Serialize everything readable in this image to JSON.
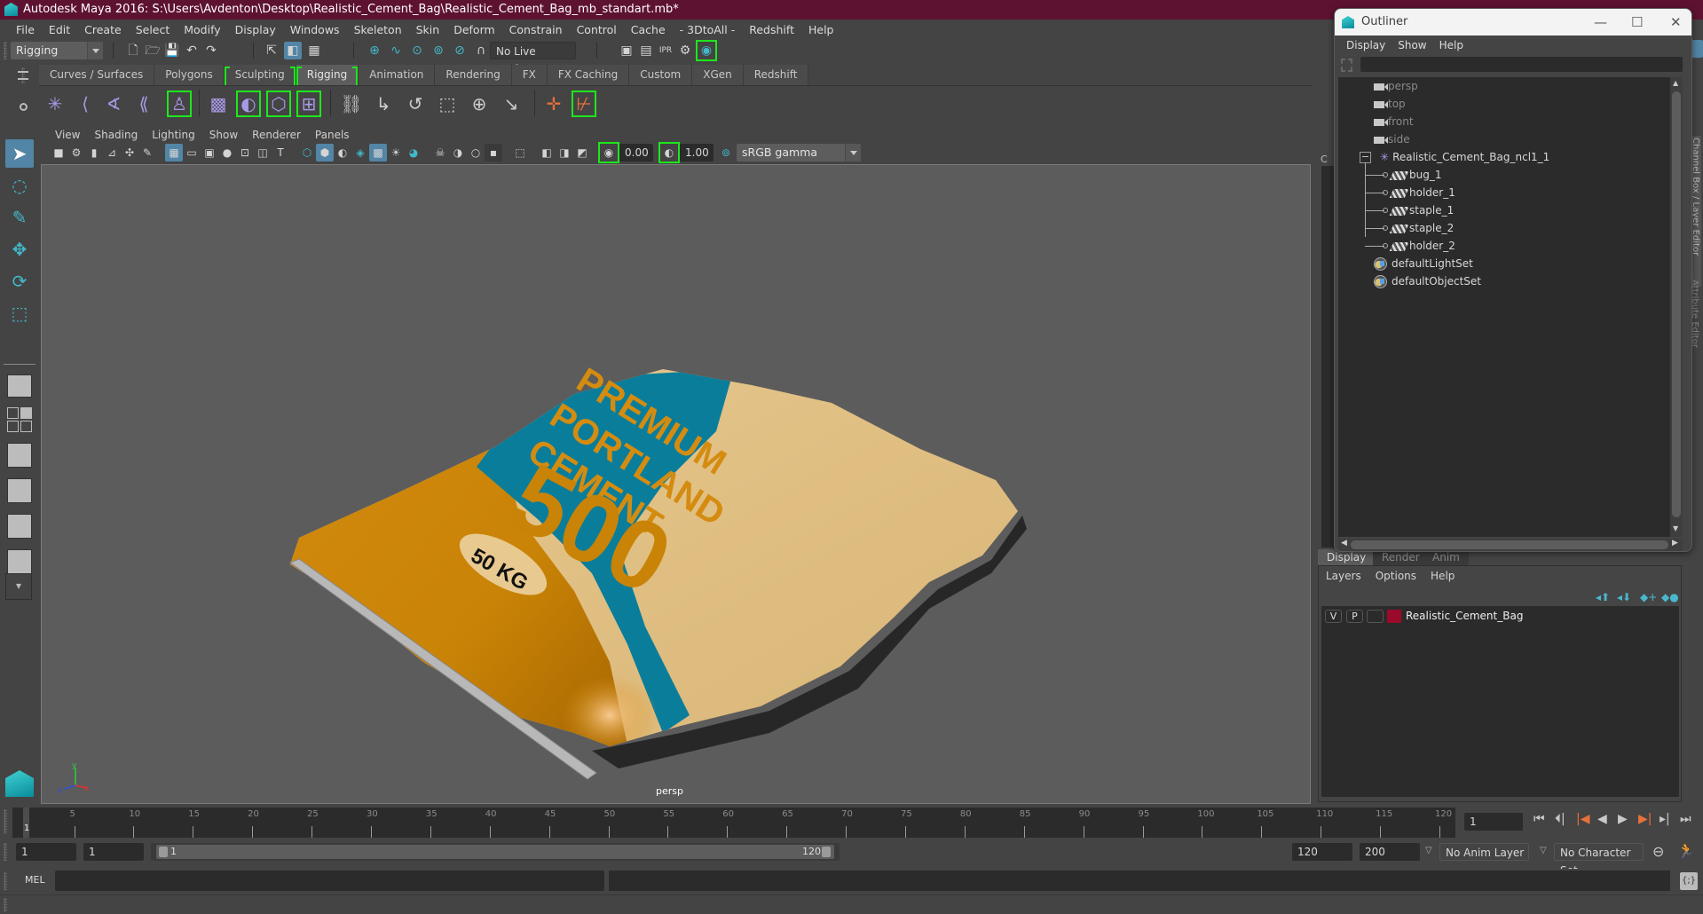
{
  "window": {
    "title": "Autodesk Maya 2016: S:\\Users\\Avdenton\\Desktop\\Realistic_Cement_Bag\\Realistic_Cement_Bag_mb_standart.mb*",
    "controls": {
      "minimize": "—",
      "maximize": "☐",
      "close": "✕"
    }
  },
  "menubar": [
    "File",
    "Edit",
    "Create",
    "Select",
    "Modify",
    "Display",
    "Windows",
    "Skeleton",
    "Skin",
    "Deform",
    "Constrain",
    "Control",
    "Cache",
    "- 3DtoAll -",
    "Redshift",
    "Help"
  ],
  "statusline": {
    "menuset": "Rigging",
    "live_surface": "No Live Surface",
    "icons": [
      "new-scene",
      "open-scene",
      "save-scene",
      "undo",
      "redo",
      "select-by-hierarchy",
      "select-by-object",
      "select-by-component",
      "snap-to-grid",
      "snap-to-curve",
      "snap-to-point",
      "snap-to-projected-center",
      "snap-to-view-plane",
      "make-live",
      "render-view",
      "render-current-frame",
      "ipr-render",
      "render-settings",
      "hypershade"
    ]
  },
  "shelf": {
    "tabs": [
      {
        "label": "Curves / Surfaces",
        "active": false,
        "bracket": false
      },
      {
        "label": "Polygons",
        "active": false,
        "bracket": false
      },
      {
        "label": "Sculpting",
        "active": false,
        "bracket": true
      },
      {
        "label": "Rigging",
        "active": true,
        "bracket": true
      },
      {
        "label": "Animation",
        "active": false,
        "bracket": false
      },
      {
        "label": "Rendering",
        "active": false,
        "bracket": false
      },
      {
        "label": "FX",
        "active": false,
        "bracket": false
      },
      {
        "label": "FX Caching",
        "active": false,
        "bracket": false
      },
      {
        "label": "Custom",
        "active": false,
        "bracket": false
      },
      {
        "label": "XGen",
        "active": false,
        "bracket": false
      },
      {
        "label": "Redshift",
        "active": false,
        "bracket": false
      }
    ],
    "icons": [
      "joint-tool",
      "ik-handle",
      "ik-spline-handle",
      "insert-joint",
      "humanik",
      "bind-skin",
      "interactive-bind",
      "lattice",
      "cluster",
      "parent-constraint",
      "point-constraint",
      "orient-constraint",
      "scale-constraint",
      "aim-constraint",
      "pole-vector-constraint",
      "create-locator",
      "mirror-joint"
    ]
  },
  "toolbox": [
    "select-tool",
    "lasso-tool",
    "paint-select-tool",
    "move-tool",
    "rotate-tool",
    "scale-tool"
  ],
  "viewport": {
    "menu": [
      "View",
      "Shading",
      "Lighting",
      "Show",
      "Renderer",
      "Panels"
    ],
    "exposure": "0.00",
    "gamma": "1.00",
    "color_space": "sRGB gamma",
    "camera_label": "persp",
    "axis": {
      "x": "x",
      "y": "y",
      "z": "z"
    },
    "bag_text": {
      "line1": "PREMIUM",
      "line2": "PORTLAND",
      "line3": "CEMENT",
      "grade": "500",
      "weight": "50 KG"
    }
  },
  "outliner": {
    "title": "Outliner",
    "menu": [
      "Display",
      "Show",
      "Help"
    ],
    "search_value": "",
    "items": [
      {
        "label": "persp",
        "type": "camera",
        "depth": 0,
        "dim": true
      },
      {
        "label": "top",
        "type": "camera",
        "depth": 0,
        "dim": true
      },
      {
        "label": "front",
        "type": "camera",
        "depth": 0,
        "dim": true
      },
      {
        "label": "side",
        "type": "camera",
        "depth": 0,
        "dim": true
      },
      {
        "label": "Realistic_Cement_Bag_ncl1_1",
        "type": "group",
        "depth": 0,
        "expanded": true
      },
      {
        "label": "bug_1",
        "type": "mesh",
        "depth": 1
      },
      {
        "label": "holder_1",
        "type": "mesh",
        "depth": 1
      },
      {
        "label": "staple_1",
        "type": "mesh",
        "depth": 1
      },
      {
        "label": "staple_2",
        "type": "mesh",
        "depth": 1
      },
      {
        "label": "holder_2",
        "type": "mesh",
        "depth": 1
      },
      {
        "label": "defaultLightSet",
        "type": "set",
        "depth": 0
      },
      {
        "label": "defaultObjectSet",
        "type": "set",
        "depth": 0
      }
    ]
  },
  "side_tabs": {
    "channel_box": "Channel Box / Layer Editor",
    "attribute_editor": "Attribute Editor"
  },
  "layer_editor": {
    "tabs": [
      {
        "label": "Display",
        "active": true
      },
      {
        "label": "Render",
        "active": false
      },
      {
        "label": "Anim",
        "active": false
      }
    ],
    "menu": [
      "Layers",
      "Options",
      "Help"
    ],
    "layers": [
      {
        "visible": "V",
        "playback": "P",
        "name": "Realistic_Cement_Bag",
        "color": "#9b0a2a"
      }
    ]
  },
  "timeline": {
    "start": 1,
    "end": 120,
    "tick_labels": [
      5,
      10,
      15,
      20,
      25,
      30,
      35,
      40,
      45,
      50,
      55,
      60,
      65,
      70,
      75,
      80,
      85,
      90,
      95,
      100,
      105,
      110,
      115,
      120
    ],
    "current_frame": "1",
    "current_frame_field": "1"
  },
  "range": {
    "start_time": "1",
    "playback_start": "1",
    "range_start_label": "1",
    "range_end_label": "120",
    "playback_end": "120",
    "end_time": "200",
    "anim_layer": "No Anim Layer",
    "character_set": "No Character Set"
  },
  "commandline": {
    "label": "MEL",
    "value": "",
    "result": ""
  },
  "colors": {
    "titlebar": "#5e1232",
    "accent_blue": "#5285a6",
    "highlight_green": "#1ee61e",
    "layer_color": "#9b0a2a"
  }
}
